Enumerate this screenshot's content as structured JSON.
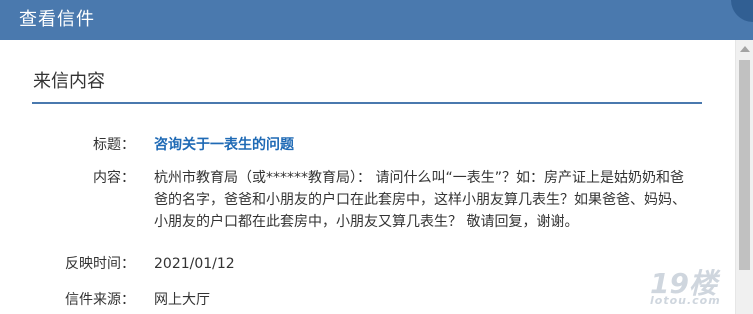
{
  "dialog": {
    "title": "查看信件"
  },
  "section": {
    "heading": "来信内容"
  },
  "fields": {
    "subject_label": "标题：",
    "subject_value": "咨询关于一表生的问题",
    "content_label": "内容：",
    "content_value": "杭州市教育局（或******教育局）： 请问什么叫“一表生”？如：房产证上是姑奶奶和爸爸的名字，爸爸和小朋友的户口在此套房中，这样小朋友算几表生？如果爸爸、妈妈、小朋友的户口都在此套房中，小朋友又算几表生？ 敬请回复，谢谢。",
    "time_label": "反映时间：",
    "time_value": "2021/01/12",
    "source_label": "信件来源：",
    "source_value": "网上大厅"
  },
  "watermark": {
    "logo_text": "19楼",
    "site_text": "lotou.com"
  },
  "colors": {
    "titlebar": "#4a79ae",
    "subject_link": "#1f6ab5",
    "divider": "#4a79ae"
  }
}
